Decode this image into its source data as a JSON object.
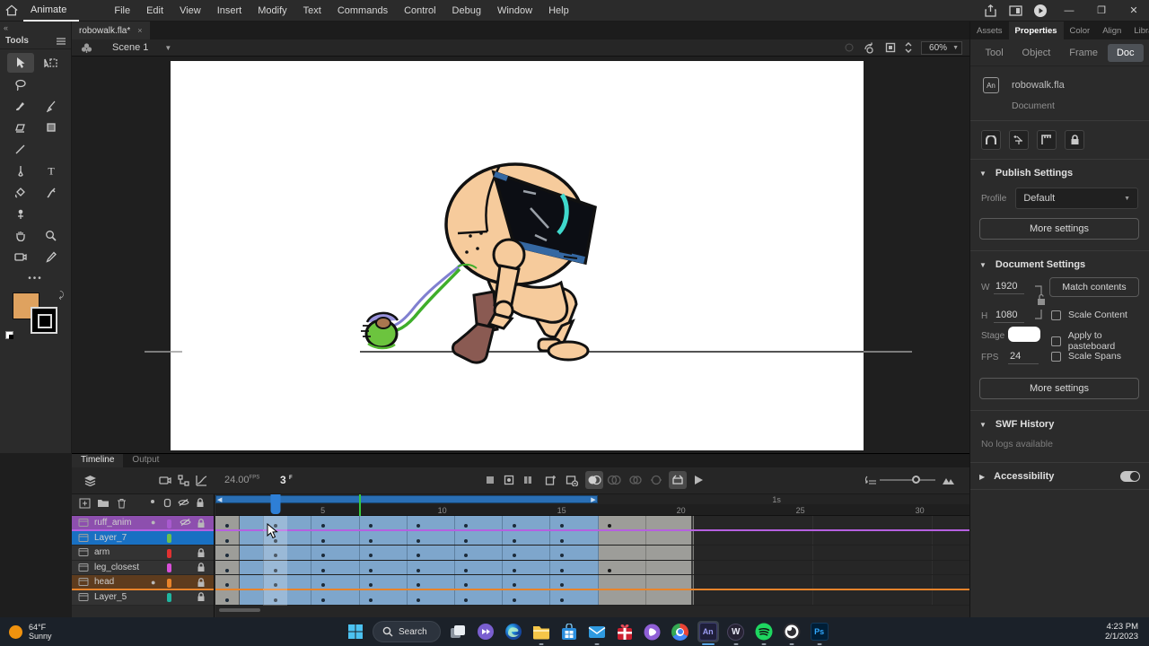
{
  "app": {
    "workspace_tab": "Animate",
    "menus": [
      "File",
      "Edit",
      "View",
      "Insert",
      "Modify",
      "Text",
      "Commands",
      "Control",
      "Debug",
      "Window",
      "Help"
    ],
    "doc_tab": {
      "title": "robowalk.fla*",
      "close": "×"
    }
  },
  "tools_panel": {
    "title": "Tools",
    "collapse": "«",
    "more": "•••",
    "fill_color": "#dfa25f",
    "stroke_color": "#000000",
    "tools": [
      "selection",
      "subselection",
      "lasso",
      "brush",
      "paintbrush",
      "eraser",
      "rectangle",
      "line",
      "pen",
      "text",
      "bucket",
      "eyedropper",
      "asset-warp",
      "hand",
      "zoom",
      "camera",
      "pencil"
    ]
  },
  "edit_bar": {
    "scene": "Scene 1",
    "zoom_value": "60%"
  },
  "right_panel": {
    "tabs": [
      "Assets",
      "Properties",
      "Color",
      "Align",
      "Library"
    ],
    "active_tab": "Properties",
    "subtabs": [
      "Tool",
      "Object",
      "Frame",
      "Doc"
    ],
    "active_subtab": "Doc",
    "doc_icon": "An",
    "filename": "robowalk.fla",
    "doctype": "Document",
    "publish": {
      "title": "Publish Settings",
      "profile_label": "Profile",
      "profile_value": "Default",
      "more_button": "More settings"
    },
    "doc_settings": {
      "title": "Document Settings",
      "w_label": "W",
      "w_value": "1920",
      "h_label": "H",
      "h_value": "1080",
      "match_button": "Match contents",
      "scale_content": "Scale Content",
      "stage_label": "Stage",
      "stage_color": "#ffffff",
      "apply_pasteboard": "Apply to pasteboard",
      "fps_label": "FPS",
      "fps_value": "24",
      "scale_spans": "Scale Spans",
      "more_button": "More settings"
    },
    "swf": {
      "title": "SWF History",
      "empty": "No logs available"
    },
    "accessibility": {
      "title": "Accessibility",
      "toggle_on": true
    }
  },
  "timeline": {
    "tabs": [
      "Timeline",
      "Output"
    ],
    "active_tab": "Timeline",
    "fps_value": "24.00",
    "fps_unit": "FPS",
    "frame_value": "3",
    "frame_unit": "F",
    "ruler_numbers": [
      5,
      10,
      15,
      20,
      25,
      30
    ],
    "seconds_marker": {
      "label": "1s",
      "frame": 24
    },
    "frames": {
      "frame_width": 26.6,
      "playhead_frame": 3,
      "green_marker_boundary": 6,
      "selection_start": 2,
      "selection_end": 16,
      "span_end": 20,
      "keyframes_odd_to": 15,
      "extra_keyframe_frame": 17
    },
    "layers": [
      {
        "name": "ruff_anim",
        "color": "#a85ad0",
        "dot": true,
        "hidden": true,
        "locked": true,
        "selected": false,
        "tint": "#8d4fae",
        "tintline": "#b560e0",
        "extra_kf": true
      },
      {
        "name": "Layer_7",
        "color": "#6cc04d",
        "dot": false,
        "hidden": false,
        "locked": false,
        "selected": true,
        "tint": "",
        "tintline": "",
        "extra_kf": false
      },
      {
        "name": "arm",
        "color": "#e03131",
        "dot": false,
        "hidden": false,
        "locked": true,
        "selected": false,
        "tint": "",
        "tintline": "",
        "extra_kf": false
      },
      {
        "name": "leg_closest",
        "color": "#d84fd8",
        "dot": false,
        "hidden": false,
        "locked": true,
        "selected": false,
        "tint": "",
        "tintline": "",
        "extra_kf": true
      },
      {
        "name": "head",
        "color": "#e8832a",
        "dot": true,
        "hidden": false,
        "locked": true,
        "selected": false,
        "tint": "#5e3c1e",
        "tintline": "#e8832a",
        "extra_kf": false
      },
      {
        "name": "Layer_5",
        "color": "#1fb5a0",
        "dot": false,
        "hidden": false,
        "locked": true,
        "selected": false,
        "tint": "",
        "tintline": "",
        "extra_kf": false
      }
    ]
  },
  "taskbar": {
    "weather": {
      "temp": "64°F",
      "condition": "Sunny"
    },
    "search_label": "Search",
    "apps": [
      {
        "name": "start"
      },
      {
        "name": "search"
      },
      {
        "name": "task-view"
      },
      {
        "name": "clipchamp"
      },
      {
        "name": "edge"
      },
      {
        "name": "file-explorer",
        "running": true
      },
      {
        "name": "store"
      },
      {
        "name": "mail",
        "running": true
      },
      {
        "name": "gift"
      },
      {
        "name": "movies-tv"
      },
      {
        "name": "chrome"
      },
      {
        "name": "animate",
        "active": true
      },
      {
        "name": "w-app",
        "running": true
      },
      {
        "name": "spotify",
        "running": true
      },
      {
        "name": "obs",
        "running": true
      },
      {
        "name": "photoshop",
        "running": true
      }
    ],
    "clock": {
      "time": "4:23 PM",
      "date": "2/1/2023"
    }
  }
}
